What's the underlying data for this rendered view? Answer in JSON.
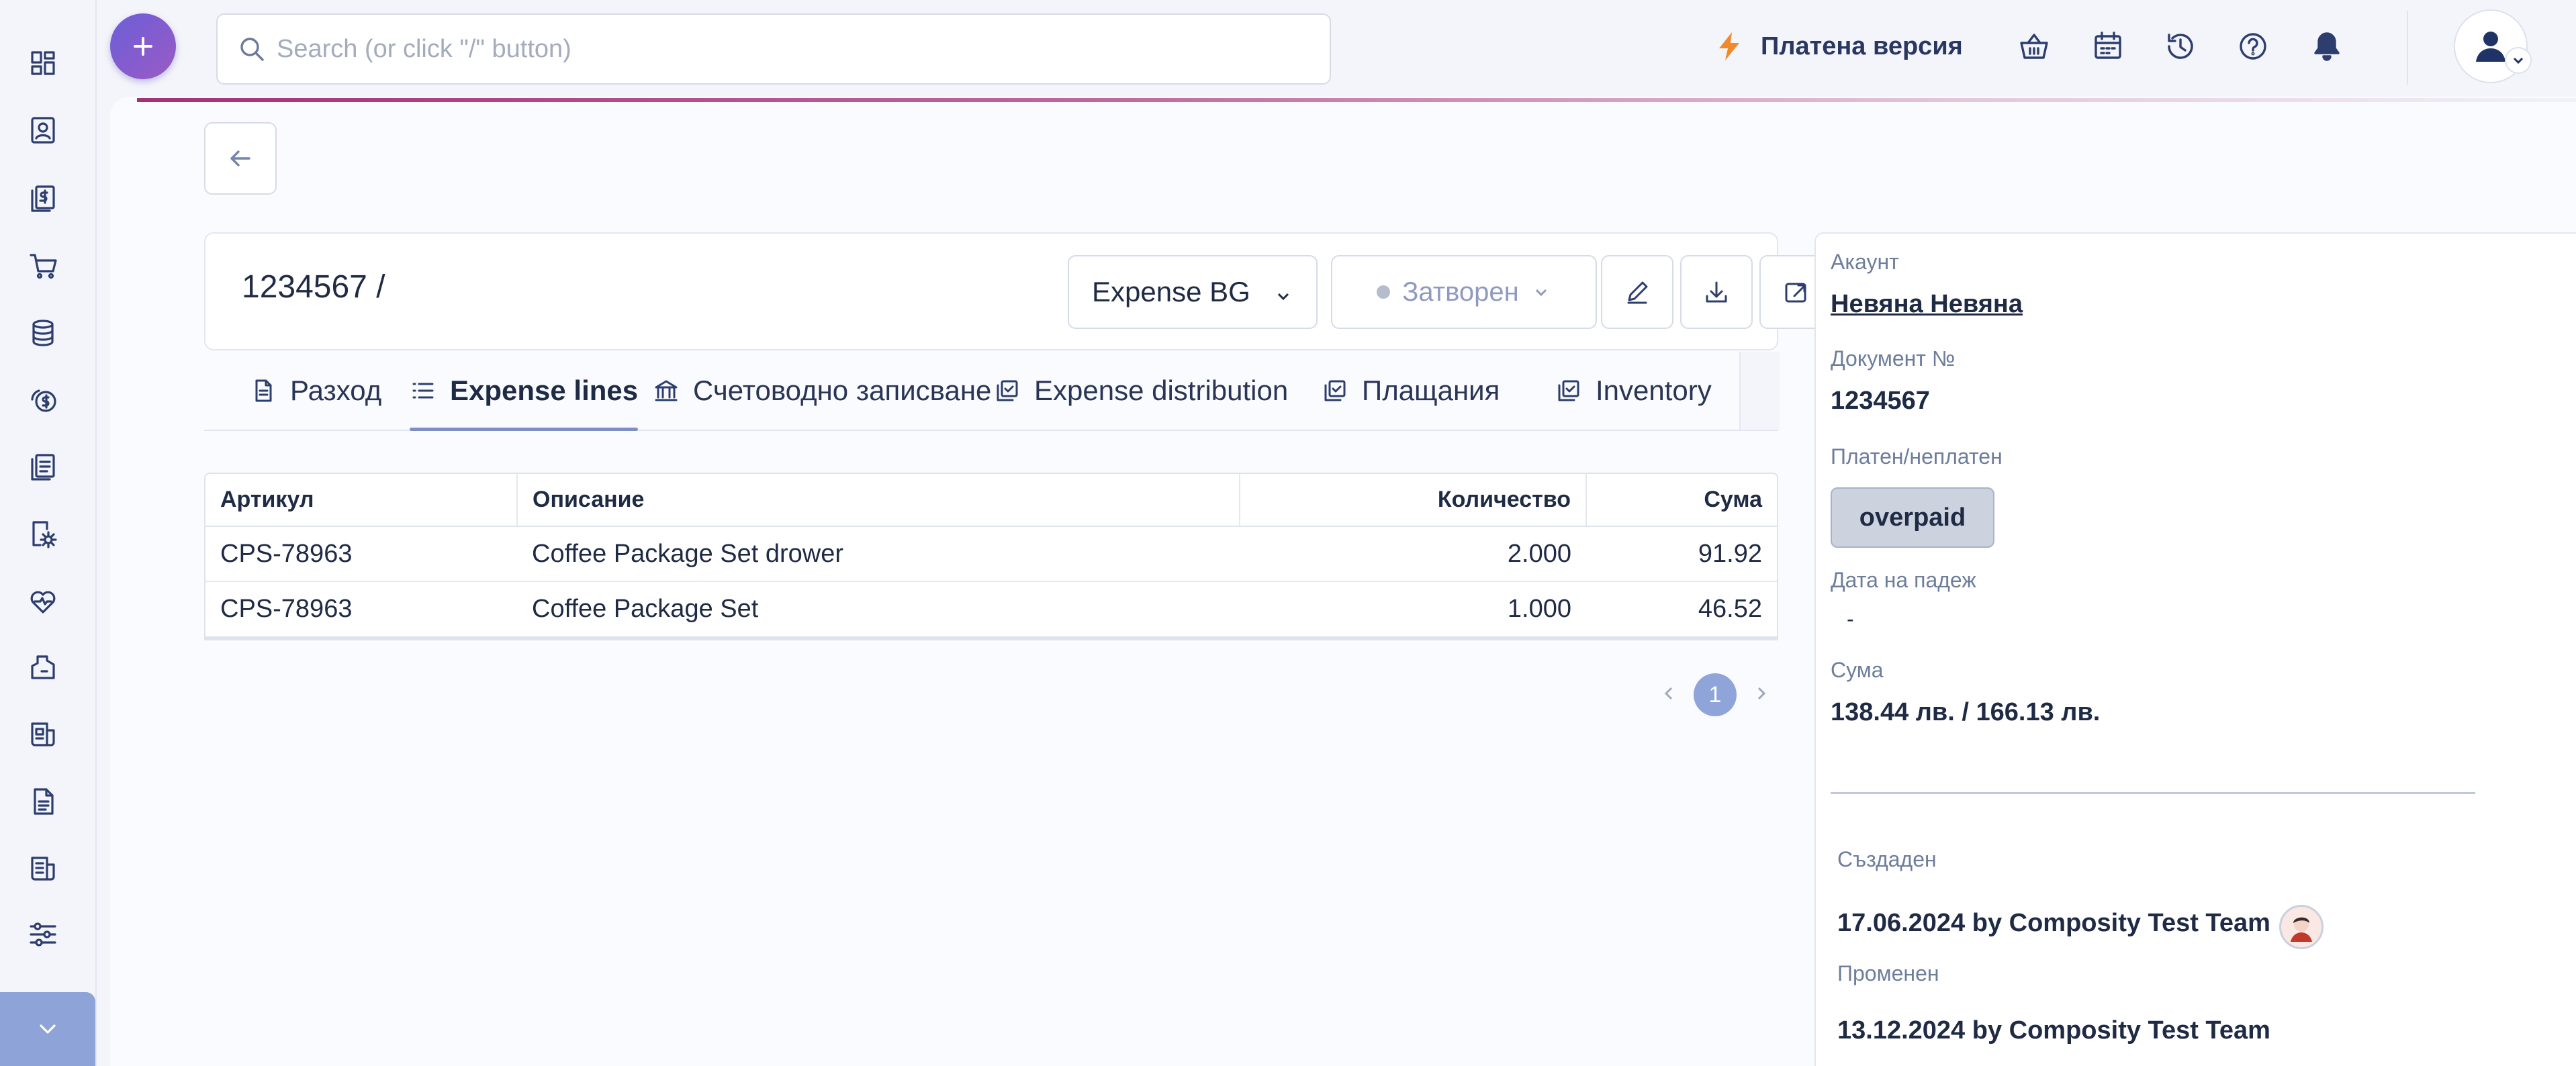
{
  "search": {
    "placeholder": "Search (or click \"/\" button)"
  },
  "topbar": {
    "plan_label": "Платена версия",
    "icons": [
      "basket-icon",
      "calendar-icon",
      "history-icon",
      "help-icon",
      "bell-icon",
      "user-icon"
    ]
  },
  "sidebar": {
    "icons": [
      "dashboard-icon",
      "contacts-icon",
      "invoices-icon",
      "cart-icon",
      "database-icon",
      "payments-icon",
      "documents-icon",
      "settings-gear-icon",
      "health-icon",
      "reports-icon",
      "news-icon",
      "file-icon",
      "newspaper-icon",
      "filters-icon"
    ]
  },
  "document": {
    "title": "1234567  /",
    "type_value": "Expense BG",
    "status_value": "Затворен"
  },
  "tabs": [
    {
      "label": "Разход"
    },
    {
      "label": "Expense lines"
    },
    {
      "label": "Счетоводно записване"
    },
    {
      "label": "Expense distribution"
    },
    {
      "label": "Плащания"
    },
    {
      "label": "Inventory"
    }
  ],
  "tabs_more": "···",
  "table": {
    "headers": [
      "Артикул",
      "Описание",
      "Количество",
      "Сума"
    ],
    "rows": [
      [
        "CPS-78963",
        "Coffee Package Set drower",
        "2.000",
        "91.92"
      ],
      [
        "CPS-78963",
        "Coffee Package Set",
        "1.000",
        "46.52"
      ]
    ]
  },
  "pagination": {
    "current": "1"
  },
  "info": {
    "account_label": "Акаунт",
    "account_value": "Невяна Невяна",
    "docno_label": "Документ №",
    "docno_value": "1234567",
    "paid_label": "Платен/неплатен",
    "paid_value": "overpaid",
    "due_label": "Дата на падеж",
    "due_value": "-",
    "amount_label": "Сума",
    "amount_value": "138.44 лв. / 166.13 лв.",
    "created_label": "Създаден",
    "created_value": "17.06.2024 by Composity Test Team",
    "modified_label": "Променен",
    "modified_value": "13.12.2024 by Composity Test Team"
  },
  "colors": {
    "accent": "#6c5ed8",
    "plan_bolt": "#f0892c",
    "page_active": "#8fa4d8",
    "sidebar_collapse": "#8ea3d8"
  }
}
